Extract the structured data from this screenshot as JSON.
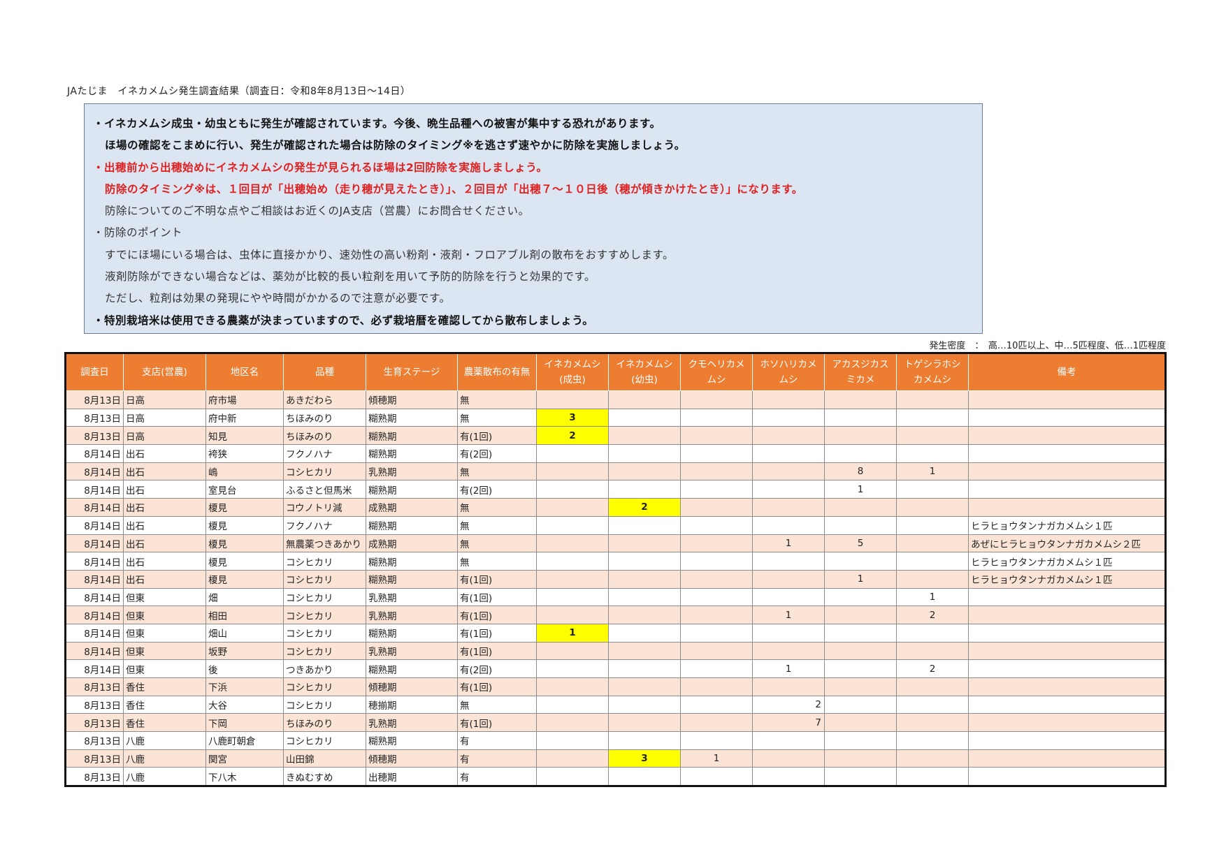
{
  "title": "JAたじま　イネカメムシ発生調査結果（調査日：令和8年8月13日～14日）",
  "notice": {
    "l1": "・イネカメムシ成虫・幼虫ともに発生が確認されています。今後、晩生品種への被害が集中する恐れがあります。",
    "l2": "ほ場の確認をこまめに行い、発生が確認された場合は防除のタイミング※を逃さず速やかに防除を実施しましょう。",
    "l3": "・出穂前から出穂始めにイネカメムシの発生が見られるほ場は2回防除を実施しましょう。",
    "l4": "防除のタイミング※は、１回目が「出穂始め（走り穂が見えたとき）」、２回目が「出穂７～１０日後（穂が傾きかけたとき）」になります。",
    "l5": "防除についてのご不明な点やご相談はお近くのJA支店（営農）にお問合せください。",
    "l6": "・防除のポイント",
    "l7": "すでにほ場にいる場合は、虫体に直接かかり、速効性の高い粉剤・液剤・フロアブル剤の散布をおすすめします。",
    "l8": "液剤防除ができない場合などは、薬効が比較的長い粒剤を用いて予防的防除を行うと効果的です。",
    "l9": "ただし、粒剤は効果の発現にやや時間がかかるので注意が必要です。",
    "l10": "・特別栽培米は使用できる農薬が決まっていますので、必ず栽培暦を確認してから散布しましょう。"
  },
  "legend": "発生密度　：　高…10匹以上、中…5匹程度、低…1匹程度",
  "headers": {
    "date": "調査日",
    "branch": "支店(営農)",
    "area": "地区名",
    "variety": "品種",
    "stage": "生育ステージ",
    "spray": "農薬散布の有無",
    "p1a": "イネカメムシ",
    "p1b": "(成虫)",
    "p2a": "イネカメムシ",
    "p2b": "(幼虫)",
    "p3a": "クモヘリカメ",
    "p3b": "ムシ",
    "p4a": "ホソハリカメ",
    "p4b": "ムシ",
    "p5a": "アカスジカス",
    "p5b": "ミカメ",
    "p6a": "トゲシラホシ",
    "p6b": "カメムシ",
    "notes": "備考"
  },
  "rows": [
    {
      "date": "8月13日",
      "branch": "日高",
      "area": "府市場",
      "variety": "あきだわら",
      "stage": "傾穂期",
      "spray": "無",
      "p1": "",
      "p2": "",
      "p3": "",
      "p4": "",
      "p5": "",
      "p6": "",
      "notes": ""
    },
    {
      "date": "8月13日",
      "branch": "日高",
      "area": "府中新",
      "variety": "ちほみのり",
      "stage": "糊熟期",
      "spray": "無",
      "p1": "3",
      "p2": "",
      "p3": "",
      "p4": "",
      "p5": "",
      "p6": "",
      "notes": ""
    },
    {
      "date": "8月13日",
      "branch": "日高",
      "area": "知見",
      "variety": "ちほみのり",
      "stage": "糊熟期",
      "spray": "有(1回)",
      "p1": "2",
      "p2": "",
      "p3": "",
      "p4": "",
      "p5": "",
      "p6": "",
      "notes": ""
    },
    {
      "date": "8月14日",
      "branch": "出石",
      "area": "袴狭",
      "variety": "フクノハナ",
      "stage": "糊熟期",
      "spray": "有(2回)",
      "p1": "",
      "p2": "",
      "p3": "",
      "p4": "",
      "p5": "",
      "p6": "",
      "notes": ""
    },
    {
      "date": "8月14日",
      "branch": "出石",
      "area": "嶋",
      "variety": "コシヒカリ",
      "stage": "乳熟期",
      "spray": "無",
      "p1": "",
      "p2": "",
      "p3": "",
      "p4": "",
      "p5": "8",
      "p6": "1",
      "notes": ""
    },
    {
      "date": "8月14日",
      "branch": "出石",
      "area": "室見台",
      "variety": "ふるさと但馬米",
      "stage": "糊熟期",
      "spray": "有(2回)",
      "p1": "",
      "p2": "",
      "p3": "",
      "p4": "",
      "p5": "1",
      "p6": "",
      "notes": ""
    },
    {
      "date": "8月14日",
      "branch": "出石",
      "area": "榎見",
      "variety": "コウノトリ減",
      "stage": "成熟期",
      "spray": "無",
      "p1": "",
      "p2": "2",
      "p3": "",
      "p4": "",
      "p5": "",
      "p6": "",
      "notes": ""
    },
    {
      "date": "8月14日",
      "branch": "出石",
      "area": "榎見",
      "variety": "フクノハナ",
      "stage": "糊熟期",
      "spray": "無",
      "p1": "",
      "p2": "",
      "p3": "",
      "p4": "",
      "p5": "",
      "p6": "",
      "notes": "ヒラヒョウタンナガカメムシ１匹"
    },
    {
      "date": "8月14日",
      "branch": "出石",
      "area": "榎見",
      "variety": "無農薬つきあかり",
      "stage": "成熟期",
      "spray": "無",
      "p1": "",
      "p2": "",
      "p3": "",
      "p4": "1",
      "p5": "5",
      "p6": "",
      "notes": "あぜにヒラヒョウタンナガカメムシ２匹"
    },
    {
      "date": "8月14日",
      "branch": "出石",
      "area": "榎見",
      "variety": "コシヒカリ",
      "stage": "糊熟期",
      "spray": "無",
      "p1": "",
      "p2": "",
      "p3": "",
      "p4": "",
      "p5": "",
      "p6": "",
      "notes": "ヒラヒョウタンナガカメムシ１匹"
    },
    {
      "date": "8月14日",
      "branch": "出石",
      "area": "榎見",
      "variety": "コシヒカリ",
      "stage": "糊熟期",
      "spray": "有(1回)",
      "p1": "",
      "p2": "",
      "p3": "",
      "p4": "",
      "p5": "1",
      "p6": "",
      "notes": "ヒラヒョウタンナガカメムシ１匹"
    },
    {
      "date": "8月14日",
      "branch": "但東",
      "area": "畑",
      "variety": "コシヒカリ",
      "stage": "乳熟期",
      "spray": "有(1回)",
      "p1": "",
      "p2": "",
      "p3": "",
      "p4": "",
      "p5": "",
      "p6": "1",
      "notes": ""
    },
    {
      "date": "8月14日",
      "branch": "但東",
      "area": "相田",
      "variety": "コシヒカリ",
      "stage": "乳熟期",
      "spray": "有(1回)",
      "p1": "",
      "p2": "",
      "p3": "",
      "p4": "1",
      "p5": "",
      "p6": "2",
      "notes": ""
    },
    {
      "date": "8月14日",
      "branch": "但東",
      "area": "畑山",
      "variety": "コシヒカリ",
      "stage": "糊熟期",
      "spray": "有(1回)",
      "p1": "1",
      "p2": "",
      "p3": "",
      "p4": "",
      "p5": "",
      "p6": "",
      "notes": ""
    },
    {
      "date": "8月14日",
      "branch": "但東",
      "area": "坂野",
      "variety": "コシヒカリ",
      "stage": "乳熟期",
      "spray": "有(1回)",
      "p1": "",
      "p2": "",
      "p3": "",
      "p4": "",
      "p5": "",
      "p6": "",
      "notes": ""
    },
    {
      "date": "8月14日",
      "branch": "但東",
      "area": "後",
      "variety": "つきあかり",
      "stage": "糊熟期",
      "spray": "有(2回)",
      "p1": "",
      "p2": "",
      "p3": "",
      "p4": "1",
      "p5": "",
      "p6": "2",
      "notes": ""
    },
    {
      "date": "8月13日",
      "branch": "香住",
      "area": "下浜",
      "variety": "コシヒカリ",
      "stage": "傾穂期",
      "spray": "有(1回)",
      "p1": "",
      "p2": "",
      "p3": "",
      "p4": "",
      "p5": "",
      "p6": "",
      "notes": ""
    },
    {
      "date": "8月13日",
      "branch": "香住",
      "area": "大谷",
      "variety": "コシヒカリ",
      "stage": "穂揃期",
      "spray": "無",
      "p1": "",
      "p2": "",
      "p3": "",
      "p4": "2",
      "p5": "",
      "p6": "",
      "notes": ""
    },
    {
      "date": "8月13日",
      "branch": "香住",
      "area": "下岡",
      "variety": "ちほみのり",
      "stage": "乳熟期",
      "spray": "有(1回)",
      "p1": "",
      "p2": "",
      "p3": "",
      "p4": "7",
      "p5": "",
      "p6": "",
      "notes": ""
    },
    {
      "date": "8月13日",
      "branch": "八鹿",
      "area": "八鹿町朝倉",
      "variety": "コシヒカリ",
      "stage": "糊熟期",
      "spray": "有",
      "p1": "",
      "p2": "",
      "p3": "",
      "p4": "",
      "p5": "",
      "p6": "",
      "notes": ""
    },
    {
      "date": "8月13日",
      "branch": "八鹿",
      "area": "関宮",
      "variety": "山田錦",
      "stage": "傾穂期",
      "spray": "有",
      "p1": "",
      "p2": "3",
      "p3": "1",
      "p4": "",
      "p5": "",
      "p6": "",
      "notes": ""
    },
    {
      "date": "8月13日",
      "branch": "八鹿",
      "area": "下八木",
      "variety": "きぬむすめ",
      "stage": "出穂期",
      "spray": "有",
      "p1": "",
      "p2": "",
      "p3": "",
      "p4": "",
      "p5": "",
      "p6": "",
      "notes": ""
    }
  ],
  "colors": {
    "header_bg": "#ed7d31",
    "stripe": "#fbe4d5",
    "highlight": "#ffff00",
    "notice_bg": "#dce6f2",
    "red_text": "#e02020"
  }
}
